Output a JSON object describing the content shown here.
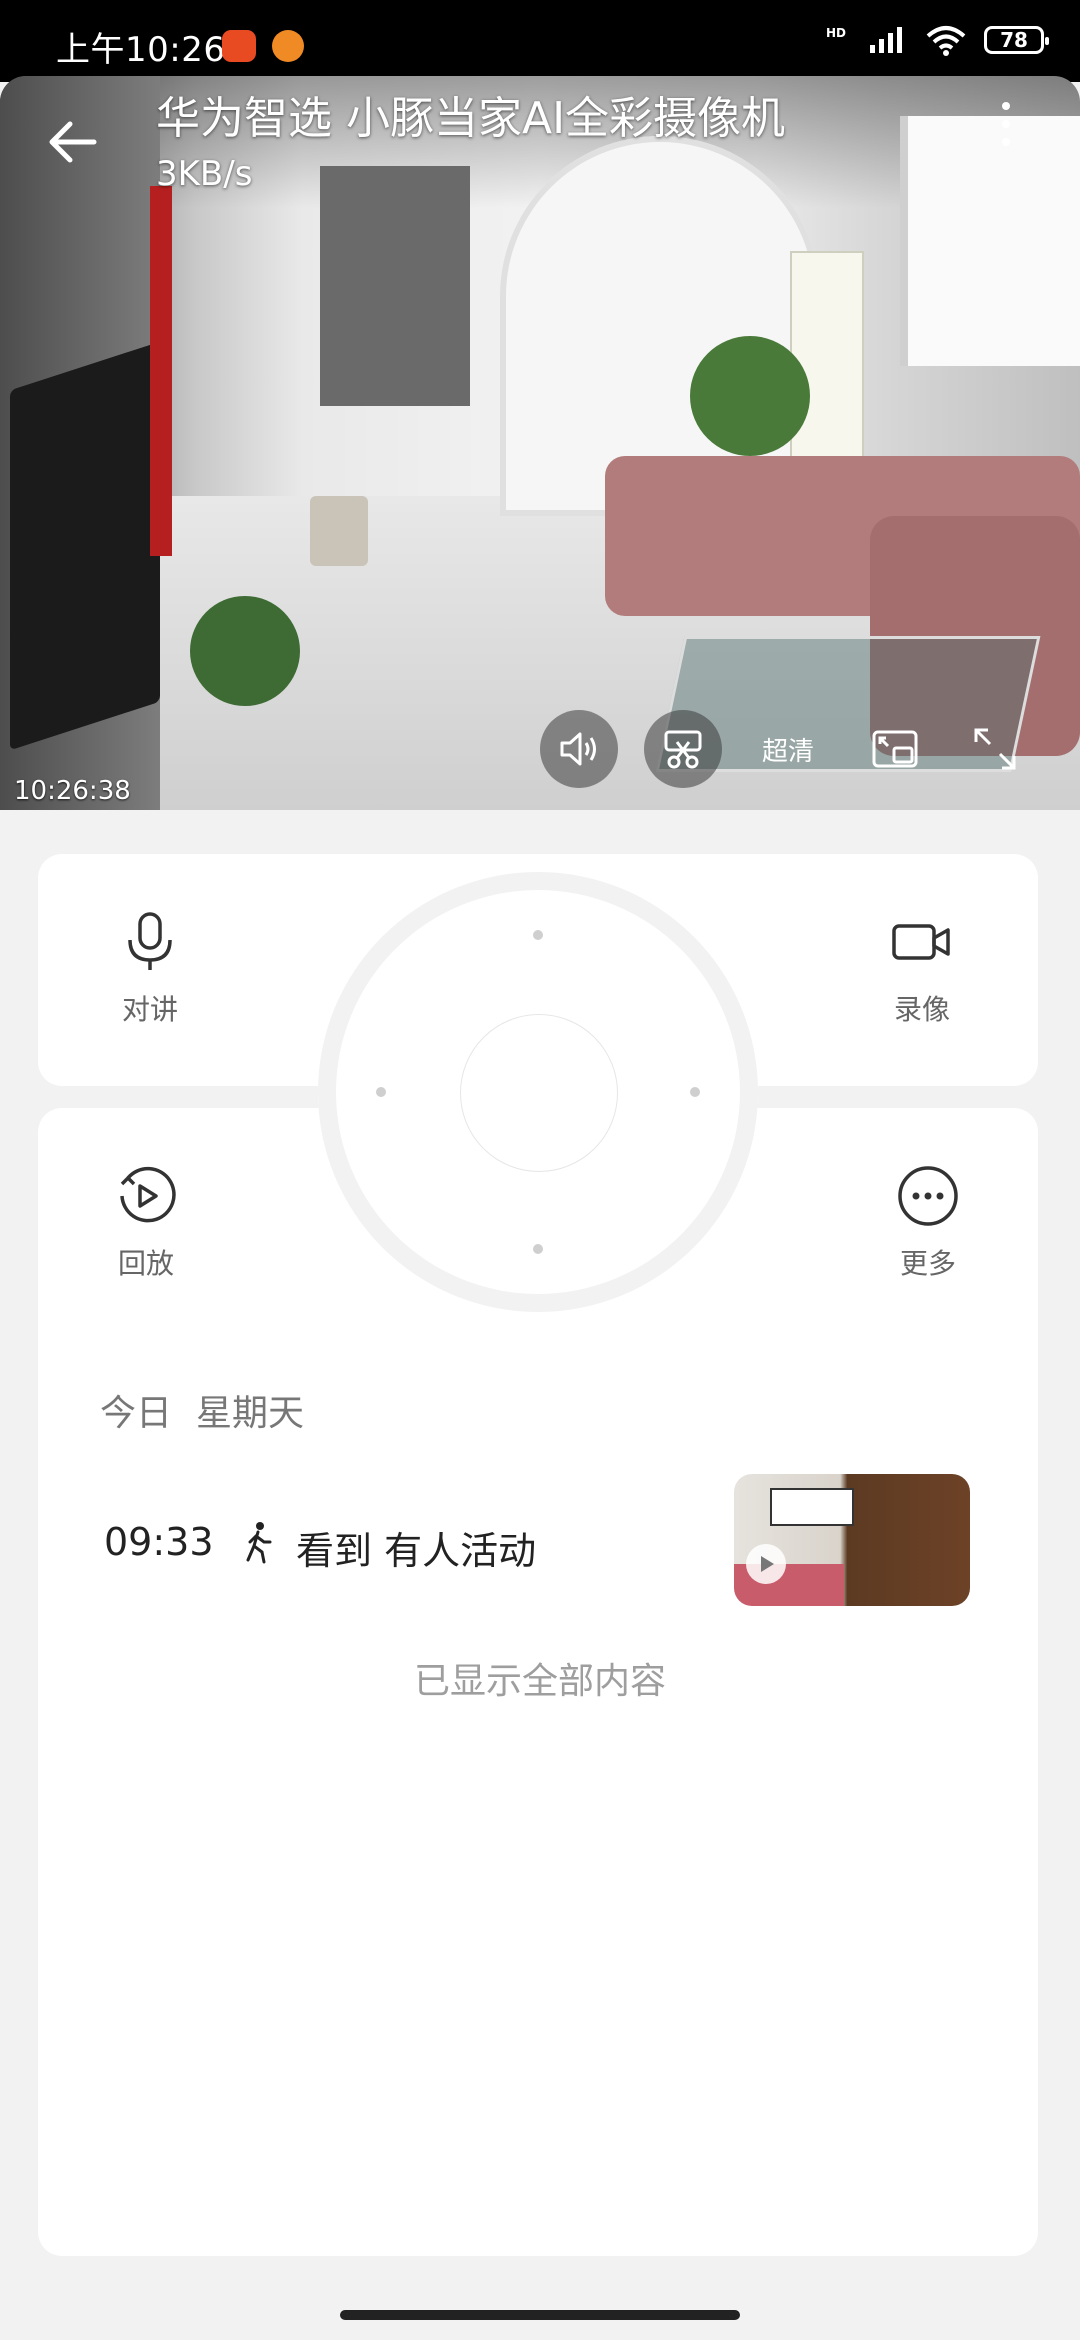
{
  "status_bar": {
    "time": "上午10:26",
    "hd_label": "HD",
    "battery": "78"
  },
  "camera": {
    "title": "华为智选 小豚当家AI全彩摄像机",
    "data_rate": "3KB/s",
    "timestamp": "10:26:38",
    "quality_label": "超清"
  },
  "controls": {
    "talk_label": "对讲",
    "record_label": "录像",
    "playback_label": "回放",
    "more_label": "更多"
  },
  "events": {
    "day_label": "今日",
    "weekday": "星期天",
    "items": [
      {
        "time": "09:33",
        "description": "看到 有人活动"
      }
    ],
    "end_message": "已显示全部内容"
  }
}
